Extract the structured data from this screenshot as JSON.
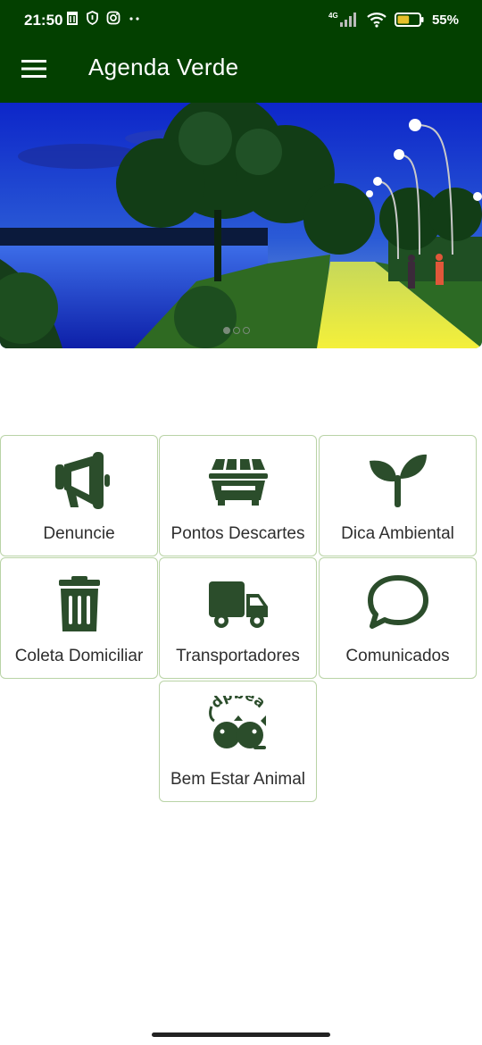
{
  "status_bar": {
    "time": "21:50",
    "network": "4G",
    "battery_percent": 55,
    "battery_text": "55%"
  },
  "toolbar": {
    "title": "Agenda Verde",
    "menu_icon": "hamburger-menu-icon"
  },
  "banner": {
    "carousel_dots": 3,
    "active_dot": 0
  },
  "tiles": [
    {
      "id": "denuncie",
      "label": "Denuncie",
      "icon": "megaphone-icon"
    },
    {
      "id": "pontos-descartes",
      "label": "Pontos Descartes",
      "icon": "dumpster-icon"
    },
    {
      "id": "dica-ambiental",
      "label": "Dica Ambiental",
      "icon": "seedling-icon"
    },
    {
      "id": "coleta-domiciliar",
      "label": "Coleta Domiciliar",
      "icon": "trash-can-icon"
    },
    {
      "id": "transportadores",
      "label": "Transportadores",
      "icon": "truck-icon"
    },
    {
      "id": "comunicados",
      "label": "Comunicados",
      "icon": "speech-bubble-icon"
    },
    {
      "id": "bem-estar-animal",
      "label": "Bem Estar Animal",
      "icon": "dpbea-logo-icon",
      "logo_text": "dpbea"
    }
  ],
  "colors": {
    "appbar": "#034000",
    "icon": "#2b4d2b",
    "tile_border": "#b9d3a6"
  }
}
